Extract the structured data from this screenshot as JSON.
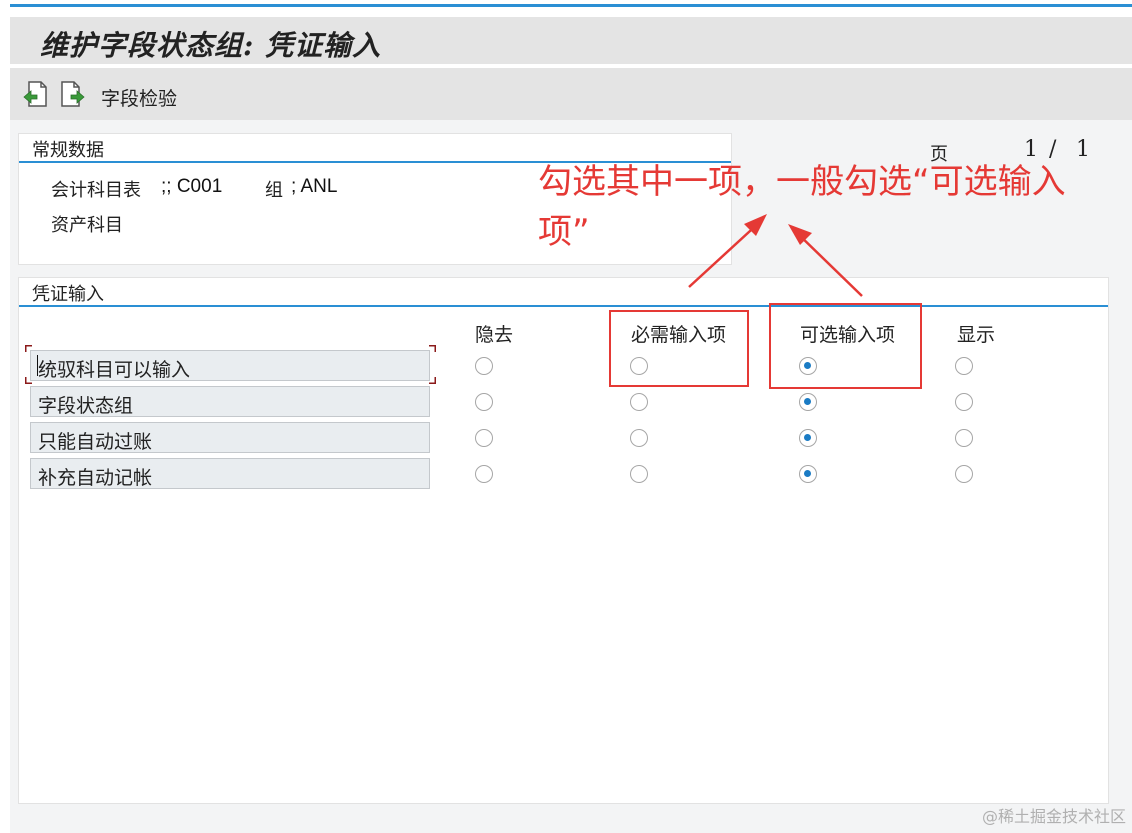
{
  "window": {
    "title": "维护字段状态组: 凭证输入"
  },
  "toolbar": {
    "icons": [
      "prev-page-icon",
      "next-page-icon"
    ],
    "field_check_label": "字段检验"
  },
  "general_data": {
    "title": "常规数据",
    "chart_of_accounts_label": "会计科目表",
    "chart_of_accounts_value": ";; C001",
    "group_label": "组",
    "group_value": "; ANL",
    "asset_account_label": "资产科目"
  },
  "pagination": {
    "page_label": "页",
    "current": "1",
    "separator": "/",
    "total": "1"
  },
  "doc_entry": {
    "title": "凭证输入",
    "columns": [
      "隐去",
      "必需输入项",
      "可选输入项",
      "显示"
    ],
    "rows": [
      {
        "label": "统驭科目可以输入",
        "selected": 2
      },
      {
        "label": "字段状态组",
        "selected": 2
      },
      {
        "label": "只能自动过账",
        "selected": 2
      },
      {
        "label": "补充自动记帐",
        "selected": 2
      }
    ]
  },
  "annotation": {
    "text": "勾选其中一项，一般勾选“可选输入项”"
  },
  "watermark": "@稀土掘金技术社区",
  "colors": {
    "accent_line": "#2a8fd4",
    "annotation_red": "#e53935",
    "radio_selected": "#1a7bc4"
  }
}
